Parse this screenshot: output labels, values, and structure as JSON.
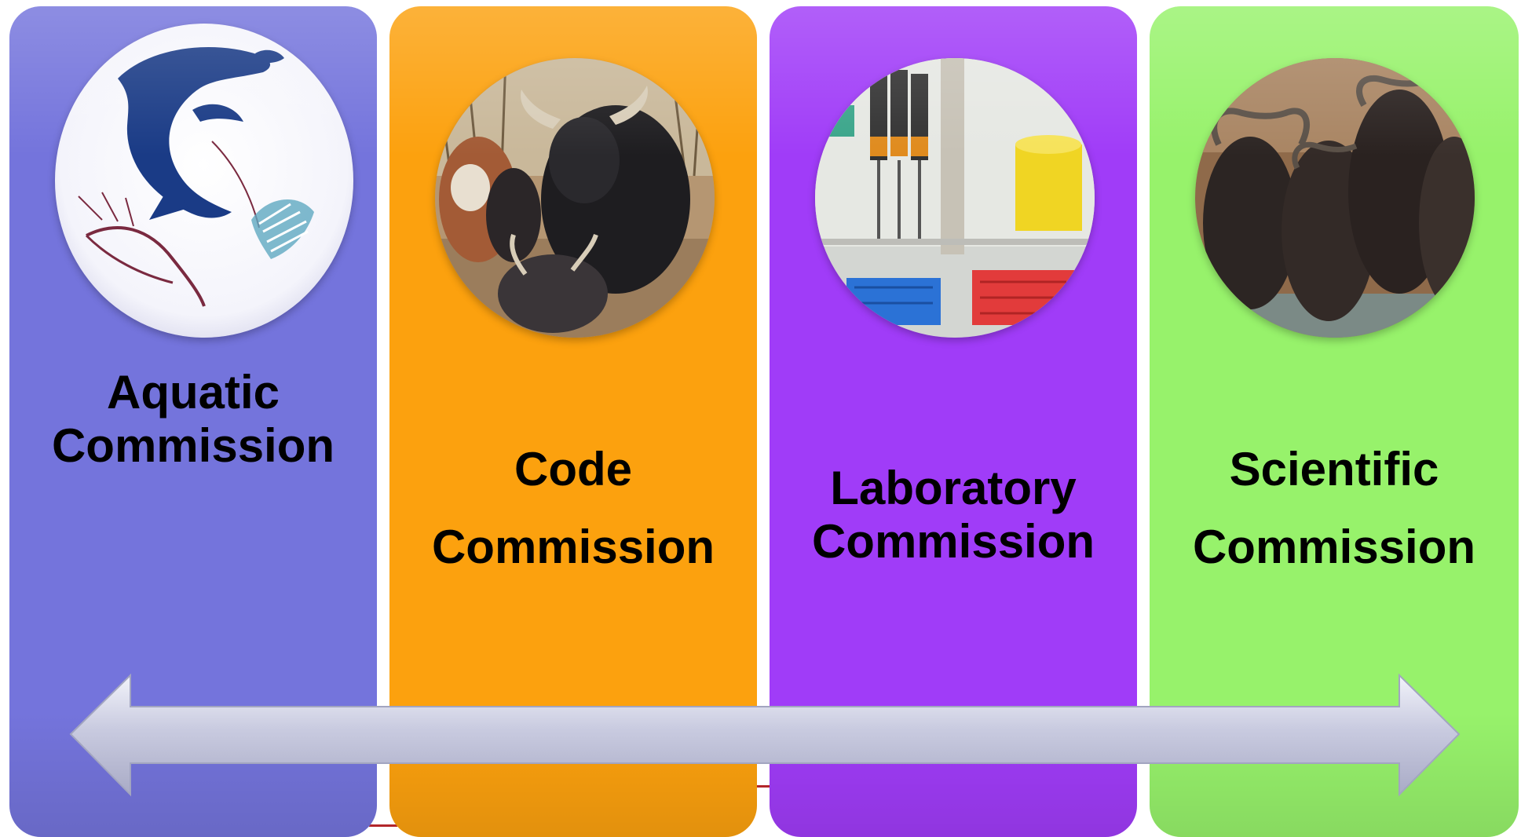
{
  "colors": {
    "aquatic": "#7474dc",
    "code": "#fca10e",
    "laboratory": "#a03cf8",
    "scientific": "#97f26b",
    "arrow": "#c9cbe0",
    "connector": "#b2262a"
  },
  "commissions": [
    {
      "line1": "Aquatic",
      "line2": "Commission",
      "icon": "fish-shrimp-logo-icon"
    },
    {
      "line1": "Code",
      "line2": "Commission",
      "icon": "cattle-photo-icon"
    },
    {
      "line1": "Laboratory",
      "line2": "Commission",
      "icon": "lab-pipettes-photo-icon"
    },
    {
      "line1": "Scientific",
      "line2": "Commission",
      "icon": "buffalo-photo-icon"
    }
  ],
  "arrow": {
    "type": "double-headed"
  }
}
